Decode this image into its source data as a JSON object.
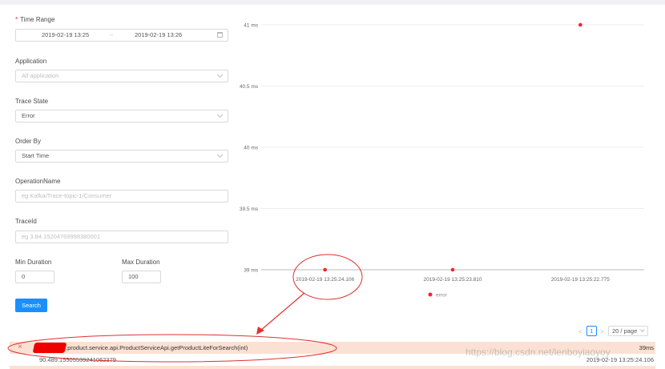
{
  "filters": {
    "time_range": {
      "label": "Time Range",
      "required_mark": "*",
      "start": "2019-02-19 13:25",
      "separator": "~",
      "end": "2019-02-19 13:26"
    },
    "application": {
      "label": "Application",
      "placeholder": "All application"
    },
    "trace_state": {
      "label": "Trace State",
      "value": "Error"
    },
    "order_by": {
      "label": "Order By",
      "value": "Start Time"
    },
    "operation_name": {
      "label": "OperationName",
      "placeholder": "eg Kafka/Trace-topic-1/Consumer"
    },
    "trace_id": {
      "label": "TraceId",
      "placeholder": "eg 3.84.15204769998380001"
    },
    "min_duration": {
      "label": "Min Duration",
      "value": "0"
    },
    "max_duration": {
      "label": "Max Duration",
      "value": "100"
    },
    "search_label": "Search"
  },
  "chart_data": {
    "type": "scatter",
    "y_ticks": [
      "41 ms",
      "40.5 ms",
      "40 ms",
      "39.5 ms",
      "39 ms"
    ],
    "ylim": [
      39,
      41
    ],
    "x_ticks": [
      "2019-02-19 13:25:24.106",
      "2019-02-19 13:25:23.810",
      "2019-02-19 13:25:22.775"
    ],
    "series": [
      {
        "name": "error",
        "color": "#f5222d",
        "points": [
          {
            "x": "2019-02-19 13:25:24.106",
            "y": 39
          },
          {
            "x": "2019-02-19 13:25:23.810",
            "y": 39
          },
          {
            "x": "2019-02-19 13:25:22.775",
            "y": 41
          }
        ]
      }
    ]
  },
  "pagination": {
    "prev": "<",
    "page": "1",
    "next": ">",
    "page_size": "20 / page"
  },
  "trace": {
    "close_icon": "×",
    "endpoint": ".product.service.api.ProductServiceApi.getProductLiteForSearch(int)",
    "duration": "39ms",
    "trace_id": "90.489.15505539241062379",
    "start_time": "2019-02-19 13:25:24.106"
  },
  "watermark": "https://blog.csdn.net/lenboyiaoyoy",
  "colors": {
    "primary": "#1890ff",
    "error": "#f5222d",
    "row_highlight": "#fbe1d3",
    "annotation": "#e03030"
  }
}
